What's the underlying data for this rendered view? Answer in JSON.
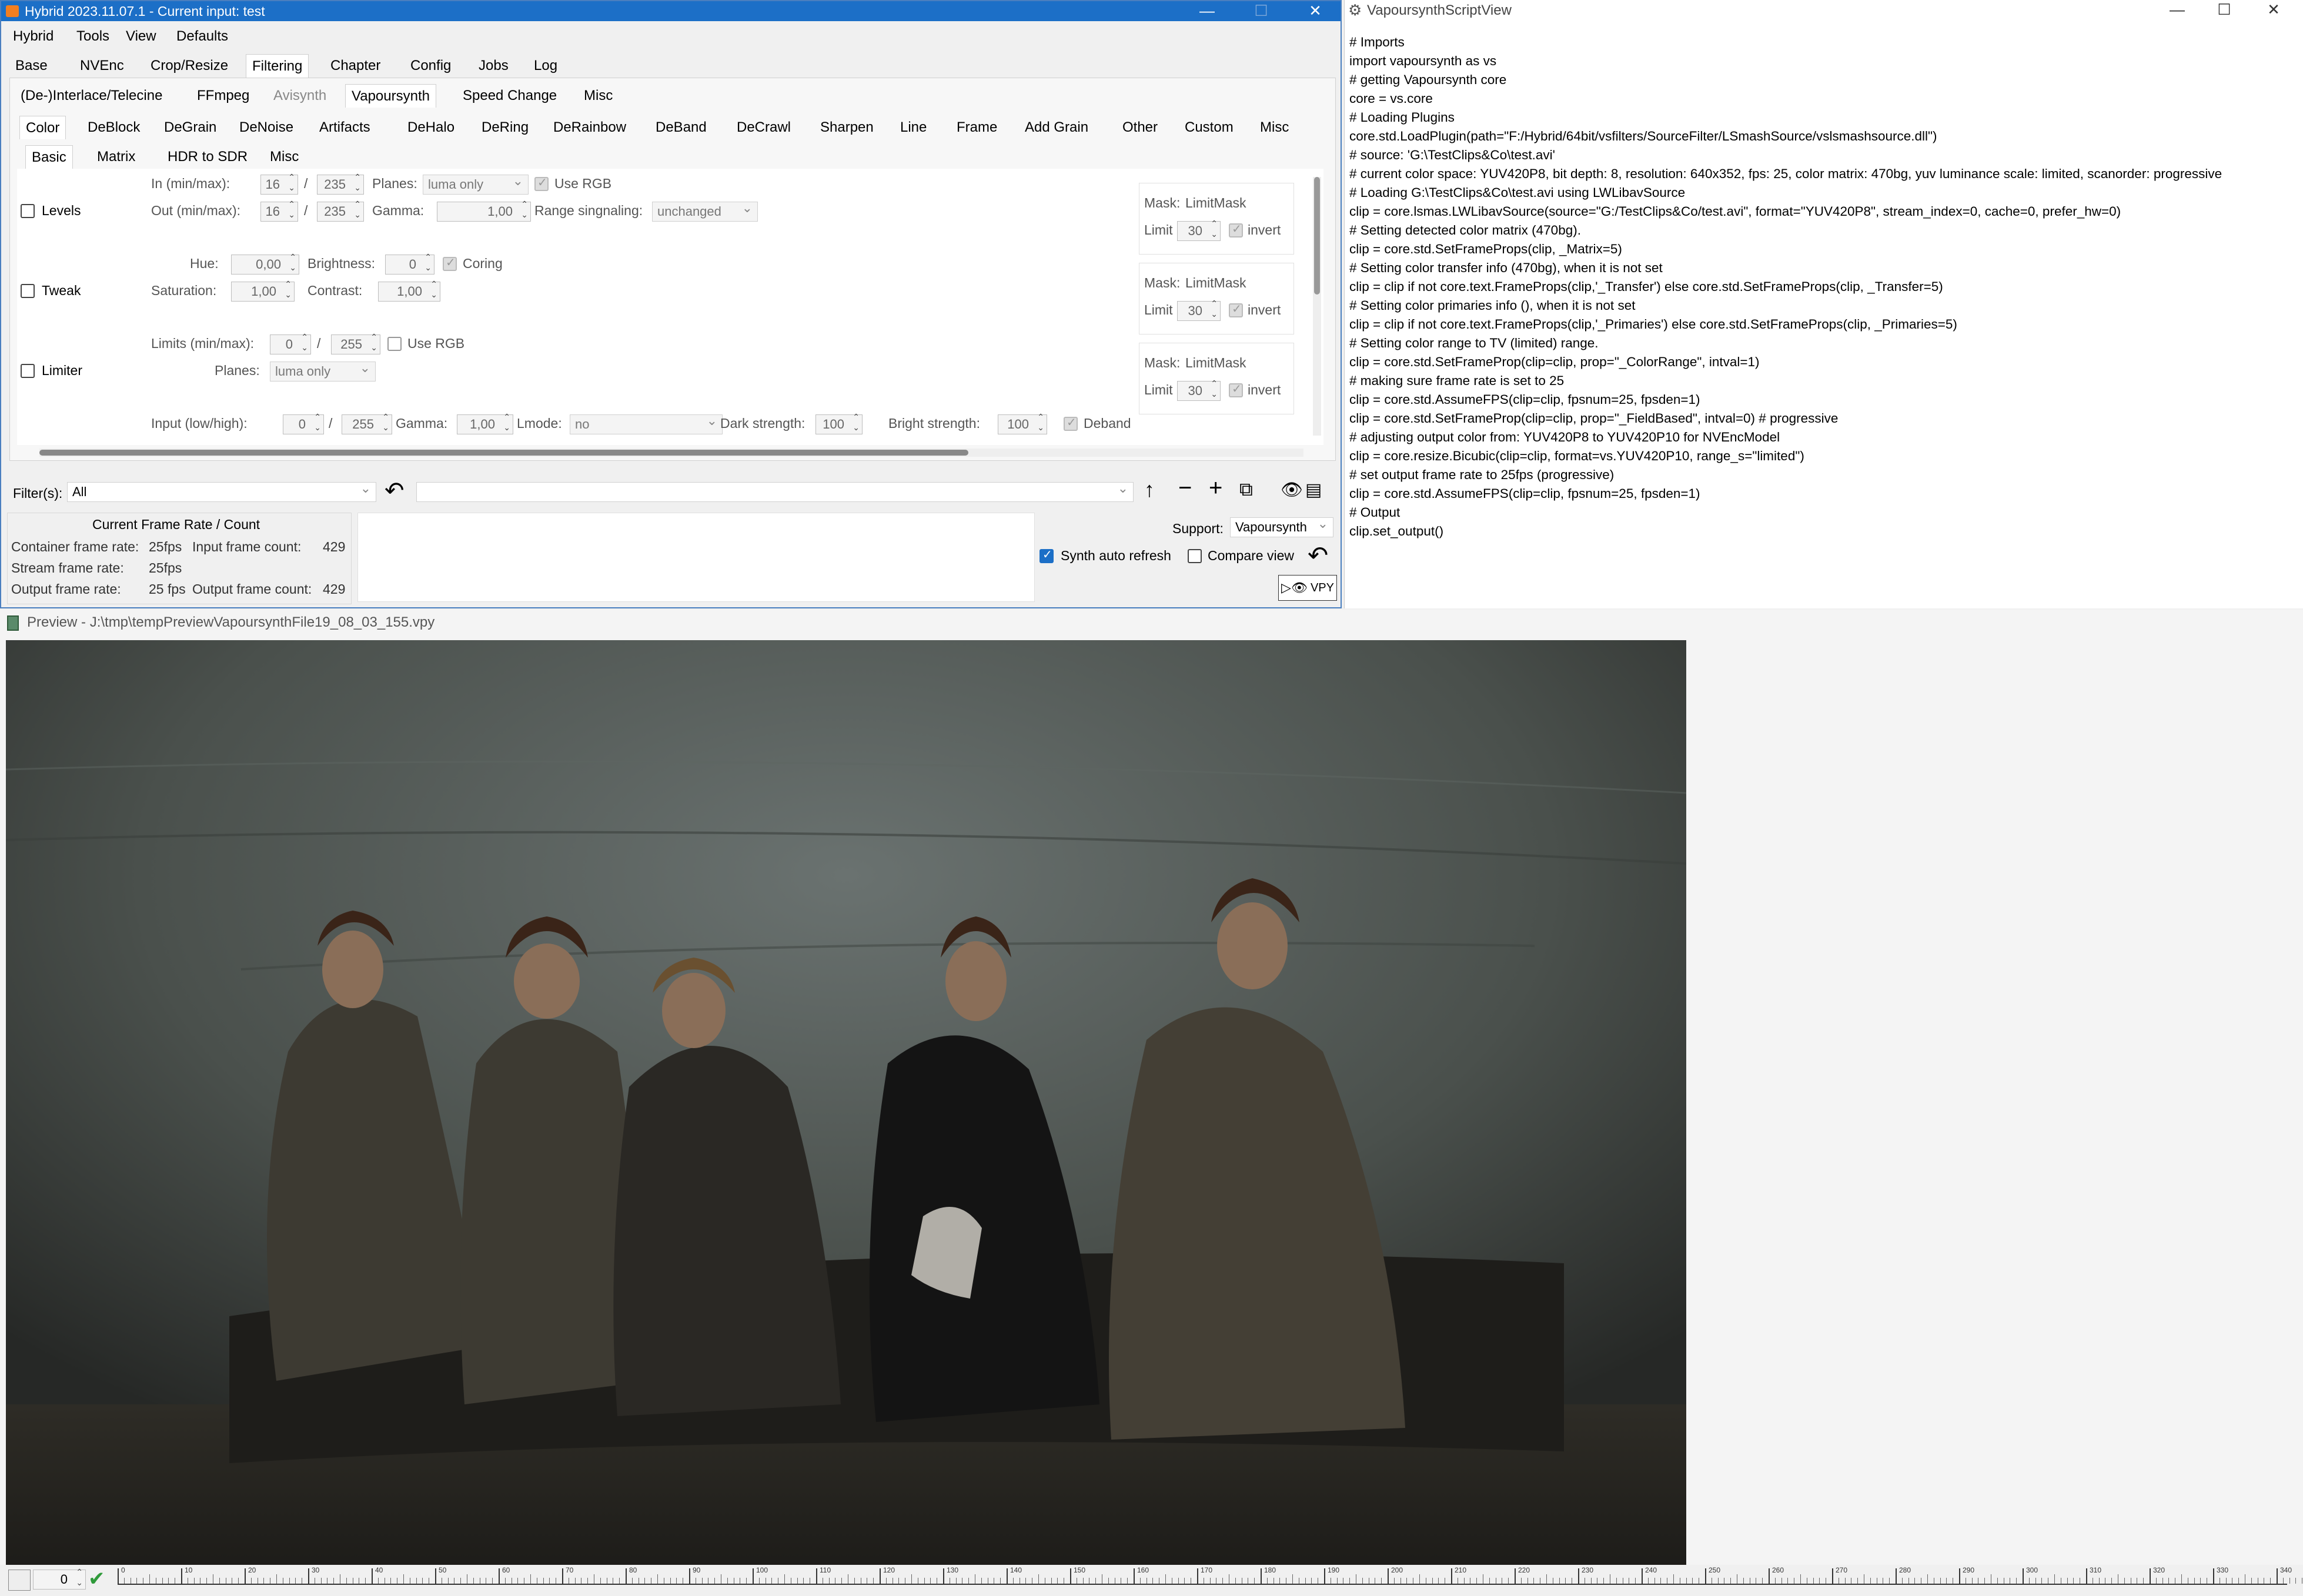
{
  "hybrid": {
    "title": "Hybrid 2023.11.07.1 - Current input: test",
    "menu": [
      "Hybrid",
      "Tools",
      "View",
      "Defaults"
    ],
    "main_tabs": [
      "Base",
      "NVEnc",
      "Crop/Resize",
      "Filtering",
      "Chapter",
      "Config",
      "Jobs",
      "Log"
    ],
    "filter_tabs": [
      "(De-)Interlace/Telecine",
      "FFmpeg",
      "Avisynth",
      "Vapoursynth",
      "Speed Change",
      "Misc"
    ],
    "vs_tabs": [
      "Color",
      "DeBlock",
      "DeGrain",
      "DeNoise",
      "Artifacts",
      "DeHalo",
      "DeRing",
      "DeRainbow",
      "DeBand",
      "DeCrawl",
      "Sharpen",
      "Line",
      "Frame",
      "Add Grain",
      "Other",
      "Custom",
      "Misc"
    ],
    "color_tabs": [
      "Basic",
      "Matrix",
      "HDR to SDR",
      "Misc"
    ],
    "levels": {
      "label": "Levels",
      "in_label": "In (min/max):",
      "in_min": "16",
      "in_max": "235",
      "out_label": "Out (min/max):",
      "out_min": "16",
      "out_max": "235",
      "slash": "/",
      "planes_label": "Planes:",
      "planes": "luma only",
      "use_rgb": "Use RGB",
      "gamma_label": "Gamma:",
      "gamma": "1,00",
      "range_label": "Range singnaling:",
      "range": "unchanged"
    },
    "tweak": {
      "label": "Tweak",
      "hue_label": "Hue:",
      "hue": "0,00",
      "brightness_label": "Brightness:",
      "brightness": "0",
      "coring": "Coring",
      "saturation_label": "Saturation:",
      "saturation": "1,00",
      "contrast_label": "Contrast:",
      "contrast": "1,00"
    },
    "limiter": {
      "label": "Limiter",
      "limits_label": "Limits (min/max):",
      "min": "0",
      "max": "255",
      "use_rgb": "Use RGB",
      "planes_label": "Planes:",
      "planes": "luma only"
    },
    "row4": {
      "input_label": "Input (low/high):",
      "low": "0",
      "high": "255",
      "gamma_label": "Gamma:",
      "gamma": "1,00",
      "lmode_label": "Lmode:",
      "lmode": "no",
      "dark_label": "Dark strength:",
      "dark": "100",
      "bright_label": "Bright strength:",
      "bright": "100",
      "deband": "Deband"
    },
    "mask": {
      "mask_label": "Mask:",
      "mask_value": "LimitMask",
      "limit_label": "Limit",
      "limit_value": "30",
      "invert": "invert"
    },
    "filters_label": "Filter(s):",
    "filters_value": "All",
    "frame_rate": {
      "header": "Current Frame Rate / Count",
      "container_label": "Container frame rate:",
      "container_value": "25fps",
      "input_count_label": "Input frame count:",
      "input_count": "429",
      "stream_label": "Stream frame rate:",
      "stream_value": "25fps",
      "output_label": "Output frame rate:",
      "output_value": "25 fps",
      "output_count_label": "Output frame count:",
      "output_count": "429"
    },
    "support_label": "Support:",
    "support_value": "Vapoursynth",
    "synth_auto_refresh": "Synth auto refresh",
    "compare_view": "Compare view",
    "vpy_label": "VPY"
  },
  "script_view": {
    "title": "VapoursynthScriptView",
    "lines": [
      "# Imports",
      "import vapoursynth as vs",
      "# getting Vapoursynth core",
      "core = vs.core",
      "# Loading Plugins",
      "core.std.LoadPlugin(path=\"F:/Hybrid/64bit/vsfilters/SourceFilter/LSmashSource/vslsmashsource.dll\")",
      "# source: 'G:\\TestClips&Co\\test.avi'",
      "# current color space: YUV420P8, bit depth: 8, resolution: 640x352, fps: 25, color matrix: 470bg, yuv luminance scale: limited, scanorder: progressive",
      "# Loading G:\\TestClips&Co\\test.avi using LWLibavSource",
      "clip = core.lsmas.LWLibavSource(source=\"G:/TestClips&Co/test.avi\", format=\"YUV420P8\", stream_index=0, cache=0, prefer_hw=0)",
      "# Setting detected color matrix (470bg).",
      "clip = core.std.SetFrameProps(clip, _Matrix=5)",
      "# Setting color transfer info (470bg), when it is not set",
      "clip = clip if not core.text.FrameProps(clip,'_Transfer') else core.std.SetFrameProps(clip, _Transfer=5)",
      "# Setting color primaries info (), when it is not set",
      "clip = clip if not core.text.FrameProps(clip,'_Primaries') else core.std.SetFrameProps(clip, _Primaries=5)",
      "# Setting color range to TV (limited) range.",
      "clip = core.std.SetFrameProp(clip=clip, prop=\"_ColorRange\", intval=1)",
      "# making sure frame rate is set to 25",
      "clip = core.std.AssumeFPS(clip=clip, fpsnum=25, fpsden=1)",
      "clip = core.std.SetFrameProp(clip=clip, prop=\"_FieldBased\", intval=0) # progressive",
      "# adjusting output color from: YUV420P8 to YUV420P10 for NVEncModel",
      "clip = core.resize.Bicubic(clip=clip, format=vs.YUV420P10, range_s=\"limited\")",
      "# set output frame rate to 25fps (progressive)",
      "clip = core.std.AssumeFPS(clip=clip, fpsnum=25, fpsden=1)",
      "# Output",
      "clip.set_output()"
    ]
  },
  "preview": {
    "title": "Preview - J:\\tmp\\tempPreviewVapoursynthFile19_08_03_155.vpy",
    "frame_value": "0",
    "ticks": [
      "0",
      "10",
      "20",
      "30",
      "40",
      "50",
      "60",
      "70",
      "80",
      "90",
      "100",
      "110",
      "120",
      "130",
      "140",
      "150",
      "160",
      "170",
      "180",
      "190",
      "200",
      "210",
      "220",
      "230",
      "240",
      "250",
      "260",
      "270",
      "280",
      "290",
      "300",
      "310",
      "320",
      "330",
      "340"
    ]
  }
}
